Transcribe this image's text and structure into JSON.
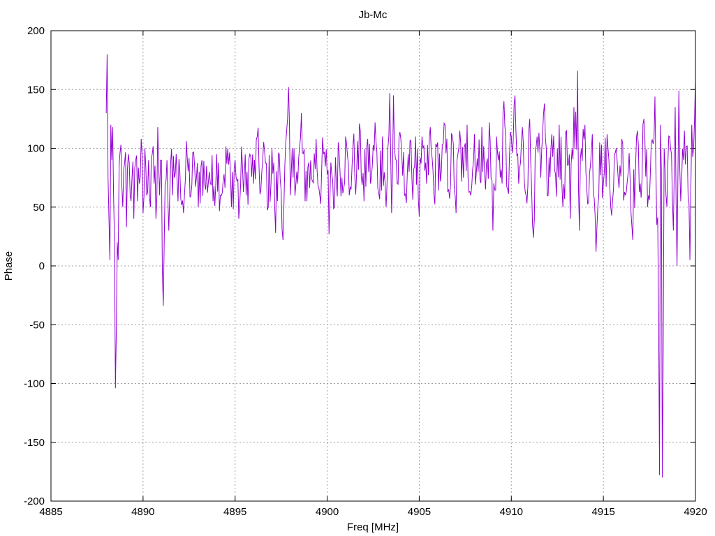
{
  "chart_data": {
    "type": "line",
    "title": "Jb-Mc",
    "xlabel": "Freq [MHz]",
    "ylabel": "Phase",
    "xlim": [
      4885,
      4920
    ],
    "ylim": [
      -200,
      200
    ],
    "x_ticks": [
      "4885",
      "4890",
      "4895",
      "4900",
      "4905",
      "4910",
      "4915",
      "4920"
    ],
    "y_ticks": [
      "200",
      "150",
      "100",
      "50",
      "0",
      "-50",
      "-100",
      "-150",
      "-200"
    ],
    "grid": true,
    "legend": "none",
    "series": [
      {
        "color": "#9400d3",
        "x_start": 4888.0,
        "x_end": 4920.0,
        "points": [
          [
            4888.0,
            130
          ],
          [
            4888.05,
            180
          ],
          [
            4888.1,
            75
          ],
          [
            4888.15,
            40
          ],
          [
            4888.2,
            5
          ],
          [
            4888.25,
            120
          ],
          [
            4888.3,
            90
          ],
          [
            4888.35,
            118
          ],
          [
            4888.4,
            60
          ],
          [
            4888.45,
            20
          ],
          [
            4888.5,
            -104
          ],
          [
            4888.55,
            -55
          ],
          [
            4888.6,
            20
          ],
          [
            4888.65,
            5
          ],
          [
            4888.7,
            85
          ],
          [
            4888.8,
            103
          ],
          [
            4888.9,
            50
          ],
          [
            4889.0,
            88
          ],
          [
            4889.1,
            33
          ],
          [
            4889.2,
            95
          ],
          [
            4889.3,
            60
          ],
          [
            4889.4,
            75
          ],
          [
            4889.5,
            40
          ],
          [
            4889.6,
            90
          ],
          [
            4889.7,
            55
          ],
          [
            4889.8,
            70
          ],
          [
            4889.9,
            108
          ],
          [
            4890.0,
            45
          ],
          [
            4890.1,
            100
          ],
          [
            4890.2,
            60
          ],
          [
            4890.3,
            90
          ],
          [
            4890.4,
            50
          ],
          [
            4890.5,
            95
          ],
          [
            4890.6,
            70
          ],
          [
            4890.7,
            40
          ],
          [
            4890.8,
            118
          ],
          [
            4890.9,
            60
          ],
          [
            4891.0,
            90
          ],
          [
            4891.05,
            -7
          ],
          [
            4891.1,
            -34
          ],
          [
            4891.15,
            20
          ],
          [
            4891.2,
            70
          ],
          [
            4891.3,
            90
          ],
          [
            4891.4,
            30
          ],
          [
            4891.5,
            88
          ],
          [
            4891.6,
            60
          ],
          [
            4891.7,
            75
          ],
          [
            4891.8,
            95
          ],
          [
            4891.9,
            55
          ],
          [
            4892.0,
            80
          ],
          [
            4892.2,
            45
          ],
          [
            4892.4,
            92
          ],
          [
            4892.6,
            60
          ],
          [
            4892.8,
            85
          ],
          [
            4893.0,
            50
          ],
          [
            4893.2,
            90
          ],
          [
            4893.4,
            65
          ],
          [
            4893.6,
            80
          ],
          [
            4893.8,
            55
          ],
          [
            4894.0,
            95
          ],
          [
            4894.2,
            60
          ],
          [
            4894.4,
            78
          ],
          [
            4894.6,
            100
          ],
          [
            4894.8,
            50
          ],
          [
            4895.0,
            90
          ],
          [
            4895.2,
            40
          ],
          [
            4895.4,
            85
          ],
          [
            4895.6,
            60
          ],
          [
            4895.8,
            95
          ],
          [
            4896.0,
            70
          ],
          [
            4896.2,
            110
          ],
          [
            4896.4,
            65
          ],
          [
            4896.6,
            98
          ],
          [
            4896.8,
            50
          ],
          [
            4897.0,
            100
          ],
          [
            4897.2,
            28
          ],
          [
            4897.4,
            95
          ],
          [
            4897.6,
            22
          ],
          [
            4897.8,
            115
          ],
          [
            4897.9,
            152
          ],
          [
            4898.0,
            60
          ],
          [
            4898.2,
            100
          ],
          [
            4898.4,
            70
          ],
          [
            4898.6,
            130
          ],
          [
            4898.8,
            55
          ],
          [
            4899.0,
            88
          ],
          [
            4899.2,
            72
          ],
          [
            4899.4,
            108
          ],
          [
            4899.6,
            60
          ],
          [
            4899.8,
            95
          ],
          [
            4900.0,
            78
          ],
          [
            4900.1,
            27
          ],
          [
            4900.2,
            88
          ],
          [
            4900.4,
            50
          ],
          [
            4900.6,
            105
          ],
          [
            4900.8,
            75
          ],
          [
            4901.0,
            110
          ],
          [
            4901.2,
            60
          ],
          [
            4901.4,
            102
          ],
          [
            4901.6,
            80
          ],
          [
            4901.8,
            115
          ],
          [
            4902.0,
            55
          ],
          [
            4902.2,
            108
          ],
          [
            4902.4,
            75
          ],
          [
            4902.6,
            122
          ],
          [
            4902.8,
            62
          ],
          [
            4903.0,
            110
          ],
          [
            4903.2,
            50
          ],
          [
            4903.4,
            147
          ],
          [
            4903.5,
            45
          ],
          [
            4903.6,
            145
          ],
          [
            4903.8,
            70
          ],
          [
            4904.0,
            108
          ],
          [
            4904.2,
            60
          ],
          [
            4904.4,
            95
          ],
          [
            4904.6,
            75
          ],
          [
            4904.8,
            110
          ],
          [
            4905.0,
            42
          ],
          [
            4905.2,
            100
          ],
          [
            4905.4,
            70
          ],
          [
            4905.6,
            118
          ],
          [
            4905.8,
            60
          ],
          [
            4906.0,
            105
          ],
          [
            4906.2,
            80
          ],
          [
            4906.4,
            120
          ],
          [
            4906.6,
            65
          ],
          [
            4906.8,
            110
          ],
          [
            4907.0,
            45
          ],
          [
            4907.2,
            115
          ],
          [
            4907.4,
            75
          ],
          [
            4907.6,
            120
          ],
          [
            4907.8,
            60
          ],
          [
            4908.0,
            112
          ],
          [
            4908.2,
            80
          ],
          [
            4908.4,
            118
          ],
          [
            4908.6,
            65
          ],
          [
            4908.8,
            122
          ],
          [
            4909.0,
            30
          ],
          [
            4909.2,
            110
          ],
          [
            4909.4,
            75
          ],
          [
            4909.6,
            140
          ],
          [
            4909.8,
            65
          ],
          [
            4910.0,
            110
          ],
          [
            4910.2,
            145
          ],
          [
            4910.4,
            70
          ],
          [
            4910.6,
            118
          ],
          [
            4910.8,
            60
          ],
          [
            4911.0,
            125
          ],
          [
            4911.2,
            24
          ],
          [
            4911.4,
            110
          ],
          [
            4911.6,
            75
          ],
          [
            4911.8,
            138
          ],
          [
            4912.0,
            60
          ],
          [
            4912.2,
            112
          ],
          [
            4912.4,
            78
          ],
          [
            4912.6,
            120
          ],
          [
            4912.8,
            50
          ],
          [
            4913.0,
            115
          ],
          [
            4913.2,
            40
          ],
          [
            4913.4,
            135
          ],
          [
            4913.6,
            166
          ],
          [
            4913.7,
            30
          ],
          [
            4913.8,
            100
          ],
          [
            4914.0,
            120
          ],
          [
            4914.2,
            55
          ],
          [
            4914.4,
            112
          ],
          [
            4914.6,
            12
          ],
          [
            4914.8,
            105
          ],
          [
            4915.0,
            70
          ],
          [
            4915.2,
            112
          ],
          [
            4915.4,
            50
          ],
          [
            4915.6,
            95
          ],
          [
            4915.8,
            75
          ],
          [
            4916.0,
            108
          ],
          [
            4916.2,
            60
          ],
          [
            4916.4,
            96
          ],
          [
            4916.6,
            22
          ],
          [
            4916.8,
            110
          ],
          [
            4917.0,
            70
          ],
          [
            4917.2,
            125
          ],
          [
            4917.4,
            50
          ],
          [
            4917.6,
            105
          ],
          [
            4917.8,
            144
          ],
          [
            4917.9,
            35
          ],
          [
            4918.0,
            -45
          ],
          [
            4918.05,
            -178
          ],
          [
            4918.1,
            120
          ],
          [
            4918.15,
            80
          ],
          [
            4918.2,
            -180
          ],
          [
            4918.25,
            -70
          ],
          [
            4918.3,
            100
          ],
          [
            4918.4,
            60
          ],
          [
            4918.6,
            110
          ],
          [
            4918.8,
            30
          ],
          [
            4918.9,
            135
          ],
          [
            4919.0,
            0
          ],
          [
            4919.1,
            149
          ],
          [
            4919.2,
            55
          ],
          [
            4919.4,
            115
          ],
          [
            4919.6,
            60
          ],
          [
            4919.7,
            5
          ],
          [
            4919.8,
            120
          ],
          [
            4919.9,
            100
          ],
          [
            4920.0,
            158
          ]
        ]
      }
    ]
  }
}
